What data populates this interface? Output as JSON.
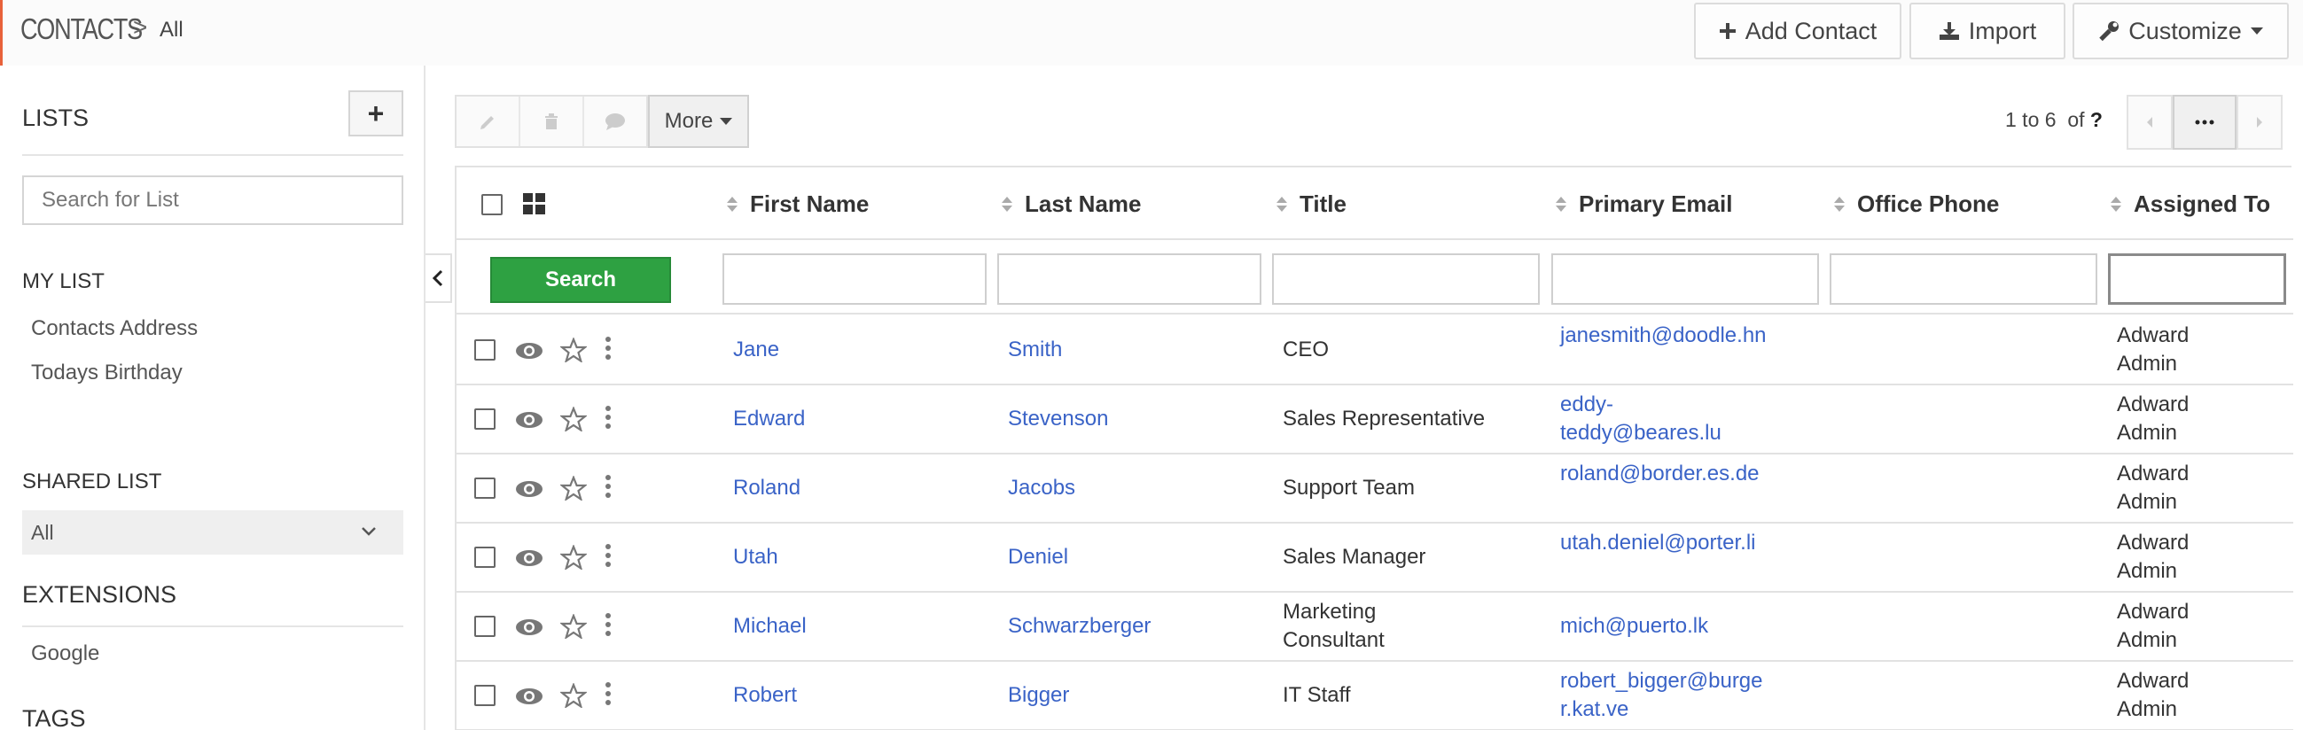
{
  "header": {
    "module": "CONTACTS",
    "separator": ">",
    "current": "All",
    "buttons": {
      "add_contact": "Add Contact",
      "import": "Import",
      "customize": "Customize"
    }
  },
  "sidebar": {
    "lists_title": "LISTS",
    "add_label": "+",
    "search_placeholder": "Search for List",
    "my_list_title": "MY LIST",
    "my_list_items": [
      "Contacts Address",
      "Todays Birthday"
    ],
    "shared_list_title": "SHARED LIST",
    "shared_list_selected": "All",
    "extensions_title": "EXTENSIONS",
    "extensions_items": [
      "Google"
    ],
    "tags_title": "TAGS"
  },
  "toolbar": {
    "more_label": "More",
    "pager_range": "1 to 6",
    "pager_of": "of",
    "pager_total": "?"
  },
  "table": {
    "columns": [
      "First Name",
      "Last Name",
      "Title",
      "Primary Email",
      "Office Phone",
      "Assigned To"
    ],
    "search_label": "Search",
    "rows": [
      {
        "first": "Jane",
        "last": "Smith",
        "title": "CEO",
        "email": "janesmith@doodle.hn",
        "phone": "",
        "assigned": "Adward Admin"
      },
      {
        "first": "Edward",
        "last": "Stevenson",
        "title": "Sales Representative",
        "email": "eddy-teddy@beares.lu",
        "phone": "",
        "assigned": "Adward Admin"
      },
      {
        "first": "Roland",
        "last": "Jacobs",
        "title": "Support Team",
        "email": "roland@border.es.de",
        "phone": "",
        "assigned": "Adward Admin"
      },
      {
        "first": "Utah",
        "last": "Deniel",
        "title": "Sales Manager",
        "email": "utah.deniel@porter.li",
        "phone": "",
        "assigned": "Adward Admin"
      },
      {
        "first": "Michael",
        "last": "Schwarzberger",
        "title": "Marketing Consultant",
        "email": "mich@puerto.lk",
        "phone": "",
        "assigned": "Adward Admin"
      },
      {
        "first": "Robert",
        "last": "Bigger",
        "title": "IT Staff",
        "email": "robert_bigger@burger.kat.ve",
        "phone": "",
        "assigned": "Adward Admin"
      }
    ]
  },
  "colors": {
    "link": "#3a63c7",
    "search_button": "#2ea142",
    "brand_accent": "#e8613a"
  }
}
